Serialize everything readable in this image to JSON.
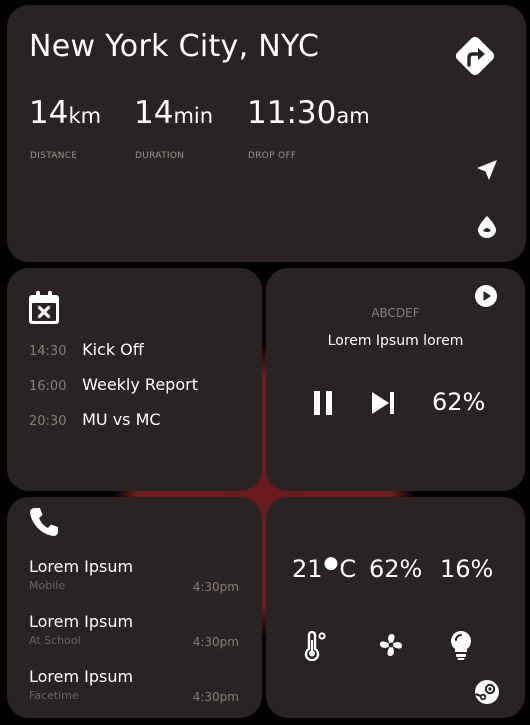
{
  "navigation": {
    "title": "New York City, NYC",
    "distance": {
      "value": "14",
      "unit": "km",
      "label": "DISTANCE"
    },
    "duration": {
      "value": "14",
      "unit": "min",
      "label": "DURATION"
    },
    "dropoff": {
      "value": "11:30",
      "unit": "am",
      "label": "DROP OFF"
    }
  },
  "calendar": {
    "events": [
      {
        "time": "14:30",
        "title": "Kick Off"
      },
      {
        "time": "16:00",
        "title": "Weekly Report"
      },
      {
        "time": "20:30",
        "title": "MU vs MC"
      }
    ]
  },
  "media": {
    "artist": "ABCDEF",
    "track": "Lorem Ipsum lorem",
    "volume": "62%"
  },
  "phone": {
    "contacts": [
      {
        "name": "Lorem Ipsum",
        "type": "Mobile",
        "time": "4:30pm"
      },
      {
        "name": "Lorem Ipsum",
        "type": "At School",
        "time": "4:30pm"
      },
      {
        "name": "Lorem Ipsum",
        "type": "Facetime",
        "time": "4:30pm"
      }
    ]
  },
  "climate": {
    "temperature": "21",
    "temp_unit": "C",
    "fan": "62%",
    "light": "16%"
  },
  "icons": {
    "directions": "turn-right-sign-icon",
    "location": "location-arrow-icon",
    "drop": "drop-icon",
    "calendar": "calendar-x-icon",
    "play": "play-circle-icon",
    "pause": "pause-icon",
    "next": "skip-next-icon",
    "phone": "phone-icon",
    "thermometer": "thermometer-icon",
    "fan": "fan-icon",
    "bulb": "bulb-icon",
    "steam": "steam-icon"
  }
}
